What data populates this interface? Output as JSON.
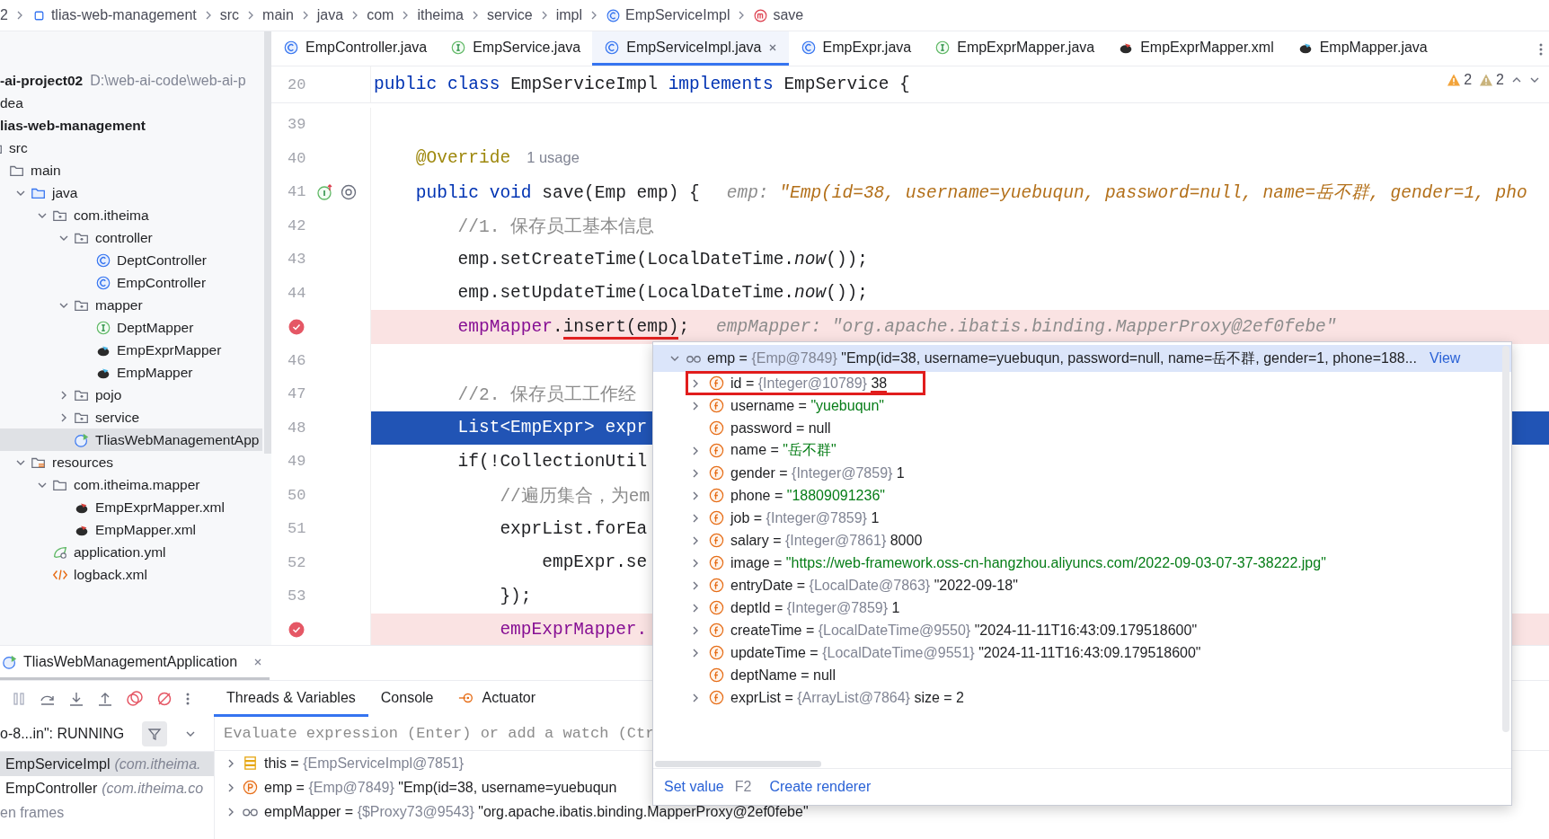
{
  "breadcrumb": [
    {
      "label": "2",
      "kind": "plain"
    },
    {
      "label": "tlias-web-management",
      "kind": "module"
    },
    {
      "label": "src",
      "kind": "plain"
    },
    {
      "label": "main",
      "kind": "plain"
    },
    {
      "label": "java",
      "kind": "plain"
    },
    {
      "label": "com",
      "kind": "plain"
    },
    {
      "label": "itheima",
      "kind": "plain"
    },
    {
      "label": "service",
      "kind": "plain"
    },
    {
      "label": "impl",
      "kind": "plain"
    },
    {
      "label": "EmpServiceImpl",
      "kind": "class"
    },
    {
      "label": "save",
      "kind": "method"
    }
  ],
  "editor_tabs": [
    {
      "label": "EmpController.java",
      "kind": "class",
      "selected": false
    },
    {
      "label": "EmpService.java",
      "kind": "interface",
      "selected": false
    },
    {
      "label": "EmpServiceImpl.java",
      "kind": "class",
      "selected": true
    },
    {
      "label": "EmpExpr.java",
      "kind": "class",
      "selected": false
    },
    {
      "label": "EmpExprMapper.java",
      "kind": "interface",
      "selected": false
    },
    {
      "label": "EmpExprMapper.xml",
      "kind": "mybatis-xml",
      "selected": false
    },
    {
      "label": "EmpMapper.java",
      "kind": "mybatis",
      "selected": false
    }
  ],
  "project_tree": [
    {
      "label": "-ai-project02",
      "note": "D:\\web-ai-code\\web-ai-p",
      "bold": true,
      "selected": false,
      "children": [
        {
          "label": "dea",
          "bold": false,
          "selected": false
        },
        {
          "label": "lias-web-management",
          "bold": true,
          "selected": false,
          "children": [
            {
              "label": "src",
              "kind": "folder",
              "bold": false,
              "selected": false,
              "children": [
                {
                  "label": "main",
                  "kind": "folder",
                  "bold": false,
                  "selected": false,
                  "children": [
                    {
                      "label": "java",
                      "kind": "source-folder",
                      "expanded": true,
                      "bold": false,
                      "selected": false,
                      "children": [
                        {
                          "label": "com.itheima",
                          "kind": "package",
                          "expanded": true,
                          "bold": false,
                          "selected": false,
                          "children": [
                            {
                              "label": "controller",
                              "kind": "package",
                              "expanded": true,
                              "bold": false,
                              "selected": false,
                              "children": [
                                {
                                  "label": "DeptController",
                                  "kind": "class",
                                  "bold": false,
                                  "selected": false
                                },
                                {
                                  "label": "EmpController",
                                  "kind": "class",
                                  "bold": false,
                                  "selected": false
                                }
                              ]
                            },
                            {
                              "label": "mapper",
                              "kind": "package",
                              "expanded": true,
                              "bold": false,
                              "selected": false,
                              "children": [
                                {
                                  "label": "DeptMapper",
                                  "kind": "interface",
                                  "bold": false,
                                  "selected": false
                                },
                                {
                                  "label": "EmpExprMapper",
                                  "kind": "mybatis",
                                  "bold": false,
                                  "selected": false
                                },
                                {
                                  "label": "EmpMapper",
                                  "kind": "mybatis",
                                  "bold": false,
                                  "selected": false
                                }
                              ]
                            },
                            {
                              "label": "pojo",
                              "kind": "package",
                              "expanded": false,
                              "bold": false,
                              "selected": false
                            },
                            {
                              "label": "service",
                              "kind": "package",
                              "expanded": false,
                              "bold": false,
                              "selected": false
                            },
                            {
                              "label": "TliasWebManagementApp",
                              "kind": "spring-app",
                              "bold": false,
                              "selected": true
                            }
                          ]
                        }
                      ]
                    },
                    {
                      "label": "resources",
                      "kind": "resources-folder",
                      "expanded": true,
                      "bold": false,
                      "selected": false,
                      "children": [
                        {
                          "label": "com.itheima.mapper",
                          "kind": "folder",
                          "expanded": true,
                          "bold": false,
                          "selected": false,
                          "children": [
                            {
                              "label": "EmpExprMapper.xml",
                              "kind": "mybatis-xml",
                              "bold": false,
                              "selected": false
                            },
                            {
                              "label": "EmpMapper.xml",
                              "kind": "mybatis-xml",
                              "bold": false,
                              "selected": false
                            }
                          ]
                        },
                        {
                          "label": "application.yml",
                          "kind": "spring-yml",
                          "bold": false,
                          "selected": false
                        },
                        {
                          "label": "logback.xml",
                          "kind": "xml",
                          "bold": false,
                          "selected": false
                        }
                      ]
                    }
                  ]
                }
              ]
            }
          ]
        }
      ]
    }
  ],
  "editor": {
    "warnings": [
      {
        "kind": "warning",
        "count": "2"
      },
      {
        "kind": "weak",
        "count": "2"
      }
    ],
    "lines": [
      {
        "number": "20",
        "kind": "sticky",
        "breakpoint": false,
        "current": false,
        "segments": [
          {
            "text": "public class ",
            "kind": "keyword"
          },
          {
            "text": "EmpServiceImpl ",
            "kind": "plain"
          },
          {
            "text": "implements ",
            "kind": "keyword"
          },
          {
            "text": "EmpService {",
            "kind": "plain"
          }
        ]
      },
      {
        "number": "39",
        "kind": "code",
        "breakpoint": false,
        "current": false
      },
      {
        "number": "40",
        "kind": "code",
        "breakpoint": false,
        "current": false,
        "segments": [
          {
            "text": "    @Override",
            "kind": "annotation"
          },
          {
            "text": "1 usage",
            "kind": "hint"
          }
        ]
      },
      {
        "number": "41",
        "kind": "method",
        "breakpoint": false,
        "current": false,
        "segments": [
          {
            "text": "    public void ",
            "kind": "keyword"
          },
          {
            "text": "save(Emp emp) {",
            "kind": "plain"
          },
          {
            "text": "emp: ",
            "kind": "label"
          },
          {
            "text": "\"Emp(id=38, username=yuebuqun, password=null, name=岳不群, gender=1, pho",
            "kind": "inline"
          }
        ]
      },
      {
        "number": "42",
        "kind": "code",
        "breakpoint": false,
        "current": false,
        "segments": [
          {
            "text": "        //1. 保存员工基本信息",
            "kind": "comment"
          }
        ]
      },
      {
        "number": "43",
        "kind": "code",
        "breakpoint": false,
        "current": false,
        "segments": [
          {
            "text": "        emp.setCreateTime(LocalDateTime.",
            "kind": "plain"
          },
          {
            "text": "now",
            "kind": "italic"
          },
          {
            "text": "());",
            "kind": "plain"
          }
        ]
      },
      {
        "number": "44",
        "kind": "code",
        "breakpoint": false,
        "current": false,
        "segments": [
          {
            "text": "        emp.setUpdateTime(LocalDateTime.",
            "kind": "plain"
          },
          {
            "text": "now",
            "kind": "italic"
          },
          {
            "text": "());",
            "kind": "plain"
          }
        ]
      },
      {
        "kind": "code",
        "breakpoint": true,
        "current": false,
        "segments": [
          {
            "text": "        empMapper",
            "kind": "field"
          },
          {
            "text": ".",
            "kind": "plain"
          },
          {
            "text": "insert(emp)",
            "kind": "plain",
            "marked": true
          },
          {
            "text": ";",
            "kind": "plain"
          },
          {
            "text": "empMapper: ",
            "kind": "label"
          },
          {
            "text": "\"org.apache.ibatis.binding.MapperProxy@2ef0febe\"",
            "kind": "label"
          }
        ]
      },
      {
        "number": "46",
        "kind": "code",
        "breakpoint": false,
        "current": false
      },
      {
        "number": "47",
        "kind": "code",
        "breakpoint": false,
        "current": false,
        "segments": [
          {
            "text": "        //2. 保存员工工作经",
            "kind": "comment"
          }
        ]
      },
      {
        "number": "48",
        "kind": "code",
        "breakpoint": false,
        "current": true,
        "segments": [
          {
            "text": "        List<EmpExpr> expr",
            "kind": "plain"
          }
        ]
      },
      {
        "number": "49",
        "kind": "code",
        "breakpoint": false,
        "current": false,
        "segments": [
          {
            "text": "        if(!CollectionUtil",
            "kind": "plain"
          }
        ]
      },
      {
        "number": "50",
        "kind": "code",
        "breakpoint": false,
        "current": false,
        "segments": [
          {
            "text": "            //遍历集合，为em",
            "kind": "comment"
          }
        ]
      },
      {
        "number": "51",
        "kind": "code",
        "breakpoint": false,
        "current": false,
        "segments": [
          {
            "text": "            exprList.forEa",
            "kind": "plain"
          }
        ]
      },
      {
        "number": "52",
        "kind": "code",
        "breakpoint": false,
        "current": false,
        "segments": [
          {
            "text": "                empExpr.se",
            "kind": "plain"
          }
        ]
      },
      {
        "number": "53",
        "kind": "code",
        "breakpoint": false,
        "current": false,
        "segments": [
          {
            "text": "            });",
            "kind": "plain"
          }
        ]
      },
      {
        "kind": "code",
        "breakpoint": true,
        "current": false,
        "segments": [
          {
            "text": "            empExprMapper.",
            "kind": "field"
          }
        ]
      }
    ]
  },
  "debug_popup": {
    "header": {
      "kind": "watch",
      "name": "emp =",
      "type": "{Emp@7849}",
      "value": "\"Emp(id=38, username=yuebuqun, password=null, name=岳不群, gender=1, phone=188...",
      "link": "View",
      "expanded": true
    },
    "rows": [
      {
        "name": "id =",
        "type": "{Integer@10789}",
        "value": "38",
        "kind": "plain",
        "expandable": true,
        "highlighted": true
      },
      {
        "name": "username =",
        "value": "\"yuebuqun\"",
        "kind": "string",
        "expandable": true,
        "highlighted": false
      },
      {
        "name": "password =",
        "value": "null",
        "kind": "plain",
        "expandable": false,
        "highlighted": false
      },
      {
        "name": "name =",
        "value": "\"岳不群\"",
        "kind": "string",
        "expandable": true,
        "highlighted": false
      },
      {
        "name": "gender =",
        "type": "{Integer@7859}",
        "value": "1",
        "kind": "plain",
        "expandable": true,
        "highlighted": false
      },
      {
        "name": "phone =",
        "value": "\"18809091236\"",
        "kind": "string",
        "expandable": true,
        "highlighted": false
      },
      {
        "name": "job =",
        "type": "{Integer@7859}",
        "value": "1",
        "kind": "plain",
        "expandable": true,
        "highlighted": false
      },
      {
        "name": "salary =",
        "type": "{Integer@7861}",
        "value": "8000",
        "kind": "plain",
        "expandable": true,
        "highlighted": false
      },
      {
        "name": "image =",
        "value": "\"https://web-framework.oss-cn-hangzhou.aliyuncs.com/2022-09-03-07-37-38222.jpg\"",
        "kind": "string",
        "expandable": true,
        "highlighted": false
      },
      {
        "name": "entryDate =",
        "type": "{LocalDate@7863}",
        "value": "\"2022-09-18\"",
        "kind": "plain",
        "expandable": true,
        "highlighted": false
      },
      {
        "name": "deptId =",
        "type": "{Integer@7859}",
        "value": "1",
        "kind": "plain",
        "expandable": true,
        "highlighted": false
      },
      {
        "name": "createTime =",
        "type": "{LocalDateTime@9550}",
        "value": "\"2024-11-11T16:43:09.179518600\"",
        "kind": "plain",
        "expandable": true,
        "highlighted": false
      },
      {
        "name": "updateTime =",
        "type": "{LocalDateTime@9551}",
        "value": "\"2024-11-11T16:43:09.179518600\"",
        "kind": "plain",
        "expandable": true,
        "highlighted": false
      },
      {
        "name": "deptName =",
        "value": "null",
        "kind": "plain",
        "expandable": false,
        "highlighted": false
      },
      {
        "name": "exprList =",
        "type": "{ArrayList@7864}",
        "value": "size = 2",
        "kind": "plain",
        "expandable": true,
        "highlighted": false
      }
    ],
    "footer": {
      "set_value": "Set value",
      "shortcut": "F2",
      "create_renderer": "Create renderer"
    }
  },
  "debug_panel": {
    "run_tab": "TliasWebManagementApplication",
    "tabs": [
      {
        "label": "Threads & Variables",
        "kind": "plain",
        "selected": true
      },
      {
        "label": "Console",
        "kind": "plain",
        "selected": false
      },
      {
        "label": "Actuator",
        "kind": "actuator",
        "selected": false
      }
    ],
    "thread": "o-8...in\": RUNNING",
    "evaluate_placeholder": "Evaluate expression (Enter) or add a watch (Ctr",
    "frames": [
      {
        "method": "EmpServiceImpl",
        "location": "(com.itheima.",
        "selected": true
      },
      {
        "method": "EmpController",
        "location": "(com.itheima.co",
        "selected": false
      }
    ],
    "hidden_frames": "en frames",
    "variables": [
      {
        "kind": "fields",
        "name": "this =",
        "type": "{EmpServiceImpl@7851}"
      },
      {
        "kind": "param",
        "name": "emp =",
        "type": "{Emp@7849}",
        "value": "\"Emp(id=38, username=yuebuqun"
      },
      {
        "kind": "watch",
        "name": "empMapper =",
        "type": "{$Proxy73@9543}",
        "value": "\"org.apache.ibatis.binding.MapperProxy@2ef0febe\""
      }
    ]
  }
}
